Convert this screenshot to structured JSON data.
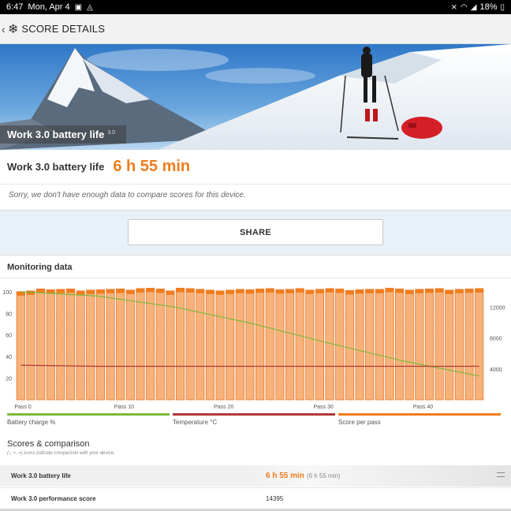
{
  "status": {
    "time": "6:47",
    "date": "Mon, Apr 4",
    "battery": "18%"
  },
  "appbar": {
    "title": "SCORE DETAILS"
  },
  "hero": {
    "label": "Work 3.0 battery life",
    "version": "3.0"
  },
  "score": {
    "label": "Work 3.0 battery life",
    "value": "6 h 55 min"
  },
  "sorry_text": "Sorry, we don't have enough data to compare scores for this device.",
  "share_label": "SHARE",
  "monitoring": {
    "title": "Monitoring data"
  },
  "legend": [
    {
      "label": "Battery charge %",
      "color": "#7cba3c"
    },
    {
      "label": "Temperature °C",
      "color": "#b33a3a"
    },
    {
      "label": "Score per pass",
      "color": "#f07d1e"
    }
  ],
  "chart_data": {
    "type": "bar",
    "x_tick_labels": [
      "Pass 0",
      "Pass 10",
      "Pass 20",
      "Pass 30",
      "Pass 40"
    ],
    "x_ticks": [
      0,
      10,
      20,
      30,
      40
    ],
    "left_axis": {
      "ticks": [
        20,
        40,
        60,
        80,
        100
      ],
      "range": [
        0,
        105
      ]
    },
    "right_axis": {
      "ticks": [
        4000,
        8000,
        12000
      ],
      "range": [
        0,
        14700
      ]
    },
    "series": [
      {
        "name": "Score per pass",
        "axis": "right",
        "values": [
          14000,
          14100,
          14350,
          14250,
          14300,
          14350,
          14100,
          14200,
          14250,
          14300,
          14350,
          14200,
          14400,
          14450,
          14350,
          14100,
          14450,
          14400,
          14300,
          14200,
          14100,
          14200,
          14300,
          14250,
          14350,
          14400,
          14250,
          14300,
          14400,
          14200,
          14300,
          14400,
          14350,
          14150,
          14250,
          14300,
          14300,
          14450,
          14350,
          14200,
          14300,
          14350,
          14400,
          14200,
          14300,
          14350,
          14400
        ]
      },
      {
        "name": "Battery charge %",
        "axis": "left",
        "values": [
          100,
          96,
          86,
          71,
          53,
          36,
          22
        ]
      },
      {
        "name": "Temperature °C",
        "axis": "left",
        "values": [
          32,
          31,
          31,
          31,
          31,
          31,
          31
        ]
      }
    ]
  },
  "scores": {
    "title": "Scores & comparison",
    "note": "(-, +, =) icons indicate comparison with your device.",
    "rows": [
      {
        "name": "Work 3.0 battery life",
        "value": "6 h 55 min",
        "sub": "(6 h 55 min)"
      },
      {
        "name": "Work 3.0 performance score",
        "value": "14395"
      }
    ]
  }
}
